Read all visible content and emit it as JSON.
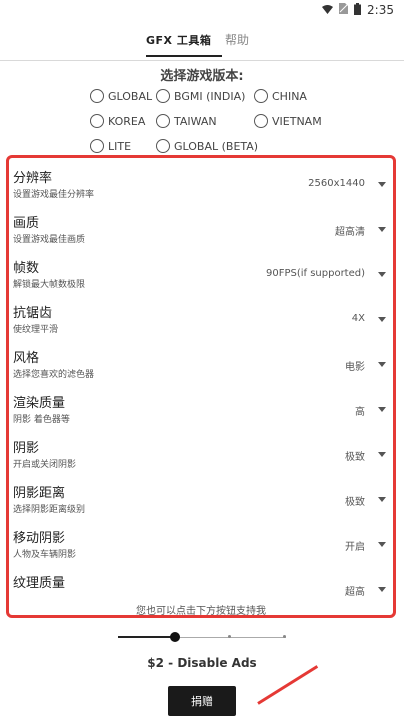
{
  "status": {
    "time": "2:35",
    "icons": [
      "wifi-icon",
      "sim-icon",
      "battery-icon"
    ]
  },
  "tabs": {
    "gfx": "GFX 工具箱",
    "help": "帮助"
  },
  "version": {
    "title": "选择游戏版本:",
    "options": [
      "GLOBAL",
      "BGMI (INDIA)",
      "CHINA",
      "KOREA",
      "TAIWAN",
      "VIETNAM",
      "LITE",
      "GLOBAL (BETA)"
    ]
  },
  "settings": [
    {
      "title": "分辨率",
      "subtitle": "设置游戏最佳分辨率",
      "value": "2560x1440"
    },
    {
      "title": "画质",
      "subtitle": "设置游戏最佳画质",
      "value": "超高清"
    },
    {
      "title": "帧数",
      "subtitle": "解锁最大帧数极限",
      "value": "90FPS(if supported)"
    },
    {
      "title": "抗锯齿",
      "subtitle": "使纹理平滑",
      "value": "4X"
    },
    {
      "title": "风格",
      "subtitle": "选择您喜欢的滤色器",
      "value": "电影"
    },
    {
      "title": "渲染质量",
      "subtitle": "阴影 着色器等",
      "value": "高"
    },
    {
      "title": "阴影",
      "subtitle": "开启或关闭阴影",
      "value": "极致"
    },
    {
      "title": "阴影距离",
      "subtitle": "选择阴影距离级别",
      "value": "极致"
    },
    {
      "title": "移动阴影",
      "subtitle": "人物及车辆阴影",
      "value": "开启"
    },
    {
      "title": "纹理质量",
      "subtitle": "",
      "value": "超高"
    }
  ],
  "support_text": "您也可以点击下方按钮支持我",
  "donation": {
    "price_label": "$2 - Disable Ads",
    "button_label": "捐赠"
  },
  "colors": {
    "highlight": "#e53935",
    "button": "#1a1a1a"
  }
}
